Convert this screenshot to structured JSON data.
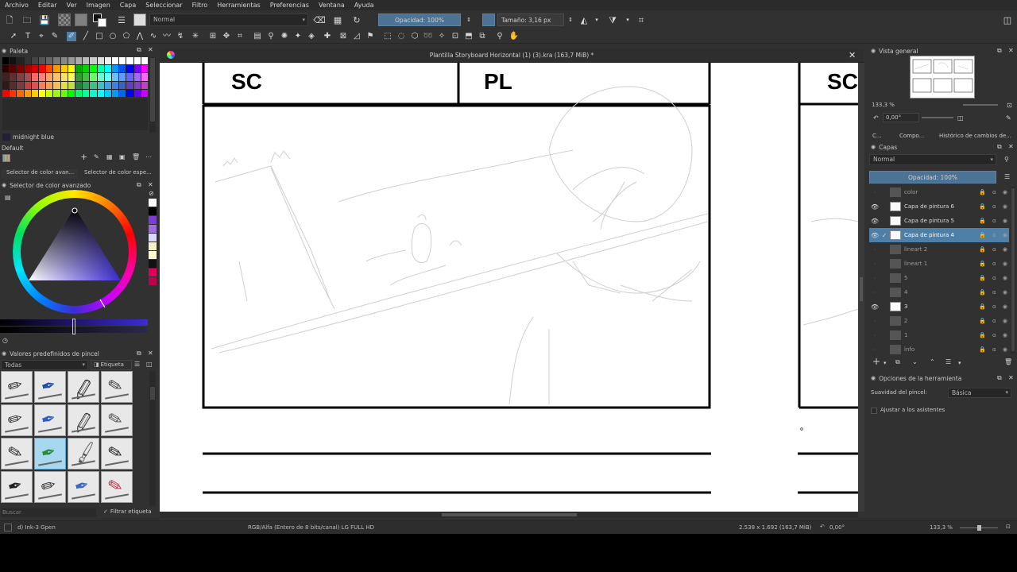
{
  "menu": [
    "Archivo",
    "Editar",
    "Ver",
    "Imagen",
    "Capa",
    "Seleccionar",
    "Filtro",
    "Herramientas",
    "Preferencias",
    "Ventana",
    "Ayuda"
  ],
  "toolbar": {
    "blend_mode": "Normal",
    "opacity_label": "Opacidad: 100%",
    "size_label": "Tamaño: 3,16 px"
  },
  "palette": {
    "title": "Paleta",
    "current_color_name": "midnight blue",
    "preset_name": "Default"
  },
  "color_tabs": [
    "Selector de color avan...",
    "Selector de color espe..."
  ],
  "advanced_color": {
    "title": "Selector de color avanzado"
  },
  "brush_presets": {
    "title": "Valores predefinidos de pincel",
    "filter_value": "Todas",
    "tag_label": "Etiqueta",
    "search_placeholder": "Buscar",
    "filter_tag_label": "Filtrar etiqueta"
  },
  "document": {
    "title": "Plantilla Storyboard Horizontal (1) (3).kra (163,7 MiB) *",
    "panel1_label_sc": "SC",
    "panel1_label_pl": "PL",
    "panel2_label_sc": "SC"
  },
  "overview": {
    "title": "Vista general",
    "zoom": "133,3 %",
    "rotation": "0,00°"
  },
  "right_tabs": [
    "C...",
    "Compo...",
    "Histórico de cambios de..."
  ],
  "layers": {
    "title": "Capas",
    "blend_mode": "Normal",
    "opacity_label": "Opacidad: 100%",
    "items": [
      {
        "name": "color",
        "visible": false,
        "active": false,
        "white_thumb": false
      },
      {
        "name": "Capa de pintura 6",
        "visible": true,
        "active": false,
        "white_thumb": true
      },
      {
        "name": "Capa de pintura 5",
        "visible": true,
        "active": false,
        "white_thumb": true
      },
      {
        "name": "Capa de pintura 4",
        "visible": true,
        "active": true,
        "white_thumb": true
      },
      {
        "name": "lineart 2",
        "visible": false,
        "active": false,
        "white_thumb": false
      },
      {
        "name": "lineart 1",
        "visible": false,
        "active": false,
        "white_thumb": false
      },
      {
        "name": "5",
        "visible": false,
        "active": false,
        "white_thumb": false
      },
      {
        "name": "4",
        "visible": false,
        "active": false,
        "white_thumb": false
      },
      {
        "name": "3",
        "visible": true,
        "active": false,
        "white_thumb": true
      },
      {
        "name": "2",
        "visible": false,
        "active": false,
        "white_thumb": false
      },
      {
        "name": "1",
        "visible": false,
        "active": false,
        "white_thumb": false
      },
      {
        "name": "info",
        "visible": false,
        "active": false,
        "white_thumb": false
      }
    ]
  },
  "tool_options": {
    "title": "Opciones de la herramienta",
    "smoothing_label": "Suavidad del pincel:",
    "smoothing_value": "Básica",
    "snap_label": "Ajustar a los asistentes"
  },
  "status": {
    "brush": "d) Ink-3 Gpen",
    "color_space": "RGB/Alfa (Entero de 8 bits/canal)  LG FULL HD",
    "dims": "2.538 x 1.692 (163,7 MiB)",
    "rotation": "0,00°",
    "zoom": "133,3 %"
  }
}
